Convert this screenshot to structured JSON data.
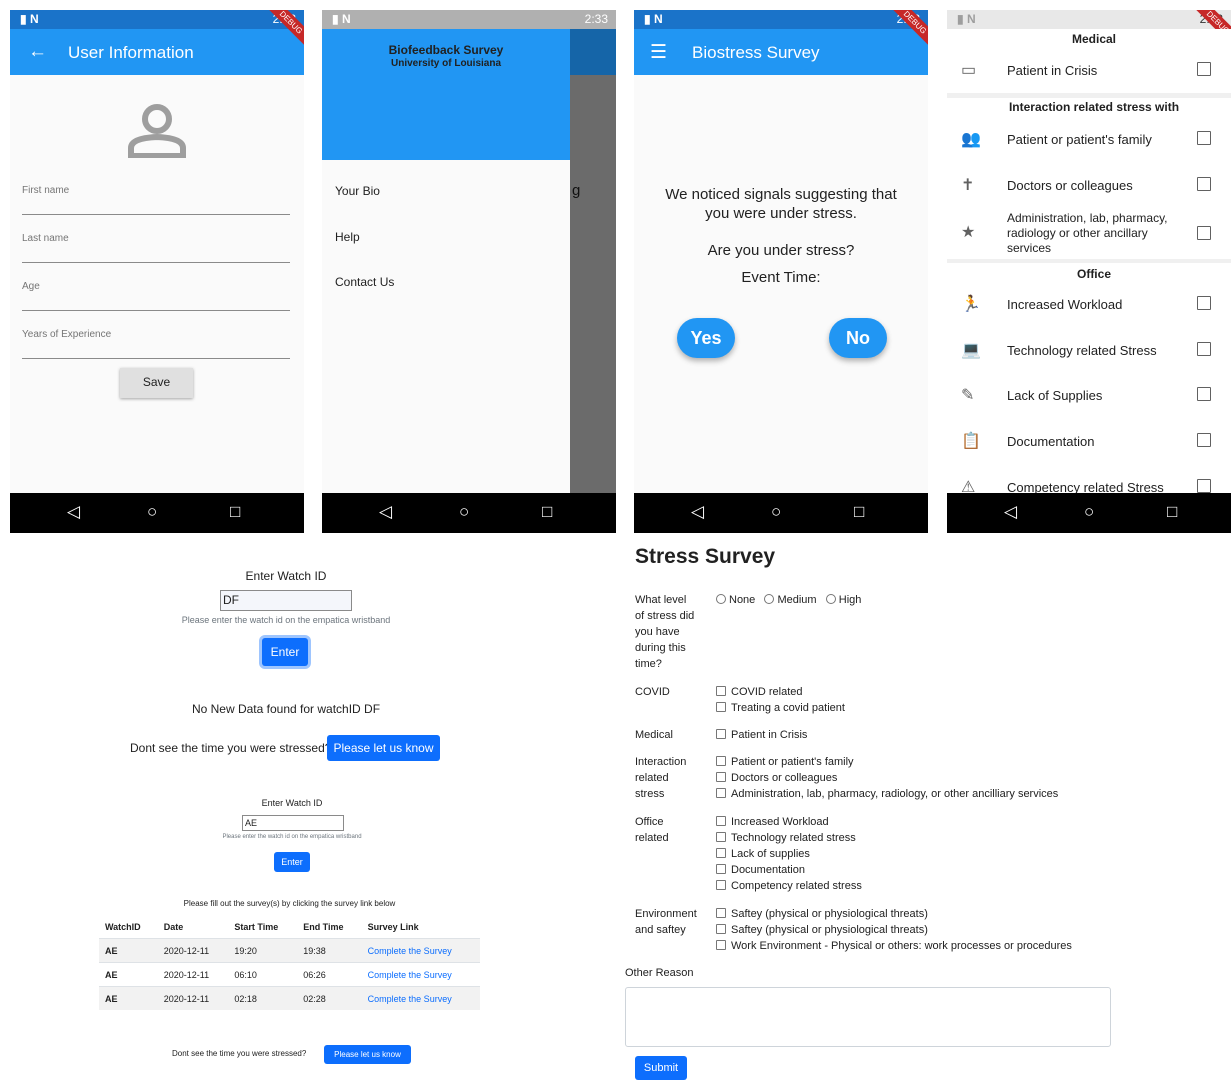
{
  "status": {
    "time": "2:33",
    "carrier": "N",
    "debug": "DEBUG"
  },
  "screen1": {
    "title": "User Information",
    "back_icon": "arrow-left-icon",
    "avatar_icon": "person-outline-icon",
    "fields": [
      "First name",
      "Last name",
      "Age",
      "Years of Experience"
    ],
    "save": "Save"
  },
  "screen2": {
    "title": "Biofeedback Survey",
    "subtitle": "University of Louisiana",
    "items": [
      "Your Bio",
      "Help",
      "Contact Us"
    ],
    "peek": "g"
  },
  "screen3": {
    "title": "Biostress Survey",
    "message": "We noticed signals suggesting that you were under stress.",
    "question": "Are you under stress?",
    "event": "Event Time:",
    "yes": "Yes",
    "no": "No"
  },
  "screen4": {
    "sections": [
      {
        "header": "Medical",
        "items": [
          {
            "label": "Patient in Crisis",
            "icon": "bed-icon"
          }
        ]
      },
      {
        "header": "Interaction related stress with",
        "items": [
          {
            "label": "Patient or patient's family",
            "icon": "people-icon"
          },
          {
            "label": "Doctors or colleagues",
            "icon": "person-standing-icon"
          },
          {
            "label": "Administration, lab, pharmacy, radiology or other ancillary services",
            "icon": "star-icon"
          }
        ]
      },
      {
        "header": "Office",
        "items": [
          {
            "label": "Increased Workload",
            "icon": "running-icon"
          },
          {
            "label": "Technology related Stress",
            "icon": "laptop-icon"
          },
          {
            "label": "Lack of Supplies",
            "icon": "pencil-icon"
          },
          {
            "label": "Documentation",
            "icon": "clipboard-icon"
          },
          {
            "label": "Competency related Stress",
            "icon": "warning-icon"
          }
        ]
      }
    ]
  },
  "web1": {
    "label": "Enter Watch ID",
    "value": "DF",
    "hint": "Please enter the watch id on the empatica wristband",
    "enter": "Enter",
    "nodata": "No New Data found for watchID DF",
    "dont_see": "Dont see the time you were stressed?",
    "let_us_know": "Please let us know"
  },
  "web2": {
    "label": "Enter Watch ID",
    "value": "AE",
    "hint": "Please enter the watch id on the empatica wristband",
    "enter": "Enter",
    "instruction": "Please fill out the survey(s) by clicking the survey link below",
    "headers": [
      "WatchID",
      "Date",
      "Start Time",
      "End Time",
      "Survey Link"
    ],
    "rows": [
      [
        "AE",
        "2020-12-11",
        "19:20",
        "19:38",
        "Complete the Survey"
      ],
      [
        "AE",
        "2020-12-11",
        "06:10",
        "06:26",
        "Complete the Survey"
      ],
      [
        "AE",
        "2020-12-11",
        "02:18",
        "02:28",
        "Complete the Survey"
      ]
    ],
    "dont_see": "Dont see the time you were stressed?",
    "let_us_know": "Please let us know"
  },
  "survey": {
    "title": "Stress Survey",
    "level_q": [
      "What level",
      "of stress did",
      "you have",
      "during this",
      "time?"
    ],
    "levels": [
      "None",
      "Medium",
      "High"
    ],
    "groups": [
      {
        "label": [
          "COVID"
        ],
        "options": [
          "COVID related",
          "Treating a covid patient"
        ]
      },
      {
        "label": [
          "Medical"
        ],
        "options": [
          "Patient in Crisis"
        ]
      },
      {
        "label": [
          "Interaction",
          "related",
          "stress"
        ],
        "options": [
          "Patient or patient's family",
          "Doctors or colleagues",
          "Administration, lab, pharmacy, radiology, or other ancilliary services"
        ]
      },
      {
        "label": [
          "Office",
          "related"
        ],
        "options": [
          "Increased Workload",
          "Technology related stress",
          "Lack of supplies",
          "Documentation",
          "Competency related stress"
        ]
      },
      {
        "label": [
          "Environment",
          "and saftey"
        ],
        "options": [
          "Saftey (physical or physiological threats)",
          "Saftey (physical or physiological threats)",
          "Work Environment - Physical or others: work processes or procedures"
        ]
      }
    ],
    "other": "Other Reason",
    "submit": "Submit"
  }
}
